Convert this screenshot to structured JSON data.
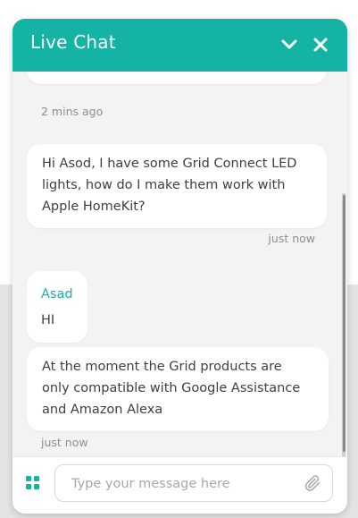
{
  "header": {
    "title": "Live Chat",
    "minimize_icon": "chevron-down-icon",
    "close_icon": "close-icon",
    "color": "#14b3a4"
  },
  "messages": [
    {
      "kind": "timestamp",
      "time": "2 mins ago"
    },
    {
      "kind": "user",
      "text": "Hi Asod, I have some Grid Connect LED lights, how do I make them work with Apple HomeKit?",
      "time": "just now"
    },
    {
      "kind": "agent",
      "sender": "Asad",
      "text": "HI"
    },
    {
      "kind": "agent",
      "text": "At the moment the Grid products are only compatible with Google Assistance and Amazon Alexa",
      "time": "just now"
    }
  ],
  "composer": {
    "placeholder": "Type your message here",
    "apps_icon": "grid-icon",
    "attach_icon": "paperclip-icon"
  }
}
